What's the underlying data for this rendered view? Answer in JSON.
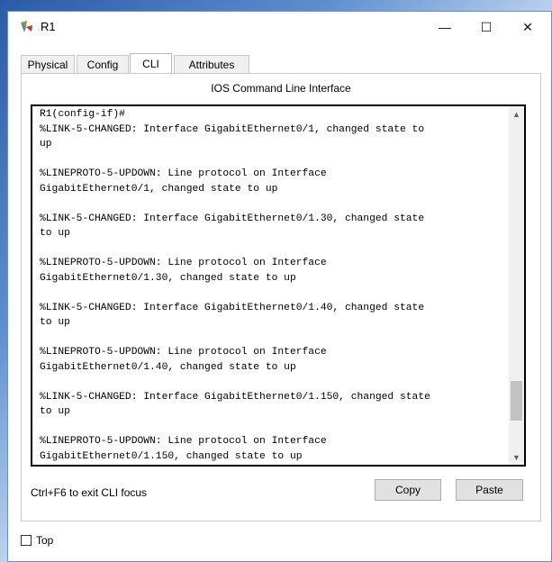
{
  "window": {
    "title": "R1",
    "minimize_symbol": "—",
    "maximize_symbol": "☐",
    "close_symbol": "✕"
  },
  "tabs": [
    {
      "label": "Physical"
    },
    {
      "label": "Config"
    },
    {
      "label": "CLI"
    },
    {
      "label": "Attributes"
    }
  ],
  "active_tab": "CLI",
  "cli": {
    "section_title": "IOS Command Line Interface",
    "output": "R1(config-if)#\n%LINK-5-CHANGED: Interface GigabitEthernet0/1, changed state to\nup\n\n%LINEPROTO-5-UPDOWN: Line protocol on Interface\nGigabitEthernet0/1, changed state to up\n\n%LINK-5-CHANGED: Interface GigabitEthernet0/1.30, changed state\nto up\n\n%LINEPROTO-5-UPDOWN: Line protocol on Interface\nGigabitEthernet0/1.30, changed state to up\n\n%LINK-5-CHANGED: Interface GigabitEthernet0/1.40, changed state\nto up\n\n%LINEPROTO-5-UPDOWN: Line protocol on Interface\nGigabitEthernet0/1.40, changed state to up\n\n%LINK-5-CHANGED: Interface GigabitEthernet0/1.150, changed state\nto up\n\n%LINEPROTO-5-UPDOWN: Line protocol on Interface\nGigabitEthernet0/1.150, changed state to up",
    "scroll_position": 0.9,
    "hint": "Ctrl+F6 to exit CLI focus",
    "copy_label": "Copy",
    "paste_label": "Paste"
  },
  "top_checkbox": {
    "label": "Top",
    "checked": false
  },
  "icons": {
    "app": "router-icon",
    "scroll_up": "chevron-up-icon",
    "scroll_down": "chevron-down-icon"
  }
}
